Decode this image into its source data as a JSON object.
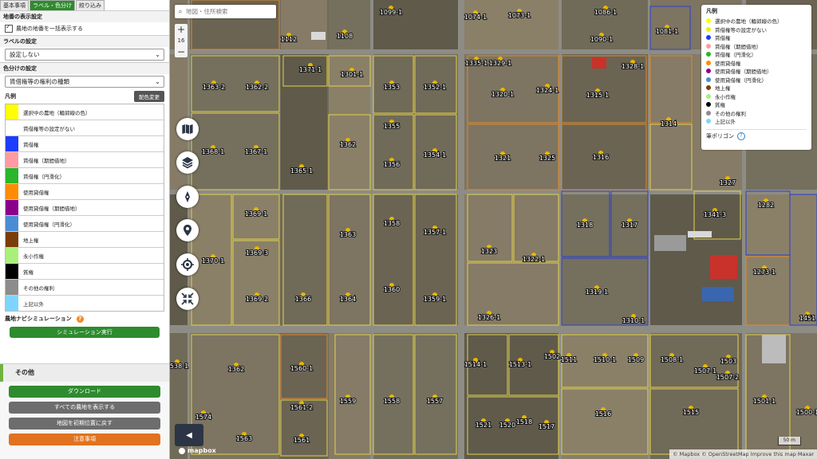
{
  "tabs": [
    "基本事項",
    "ラベル・色分け",
    "絞り込み"
  ],
  "display": {
    "section_title": "地番の表示設定",
    "show_all_label": "農地の地番を一括表示する"
  },
  "label_setting": {
    "title": "ラベルの設定",
    "value": "設定しない"
  },
  "color_setting": {
    "title": "色分けの設定",
    "value": "賃借権等の権利の種類"
  },
  "legend": {
    "title": "凡例",
    "change_button": "配色変更",
    "items": [
      {
        "label": "選択中の農地（輪郭線の色）",
        "color": "#ffff00"
      },
      {
        "label": "賃借権等の設定がない",
        "color": "#ffffff"
      },
      {
        "label": "賃借権",
        "color": "#1a3dff"
      },
      {
        "label": "賃借権（期間借地）",
        "color": "#ff9aa2"
      },
      {
        "label": "賃借権（円滑化）",
        "color": "#2ab52a"
      },
      {
        "label": "使用貸借権",
        "color": "#ff8c00"
      },
      {
        "label": "使用貸借権（期間借地）",
        "color": "#8b008b"
      },
      {
        "label": "使用貸借権（円滑化）",
        "color": "#4a8cd4"
      },
      {
        "label": "地上権",
        "color": "#7a3d0a"
      },
      {
        "label": "永小作権",
        "color": "#a8f07a"
      },
      {
        "label": "質権",
        "color": "#000000"
      },
      {
        "label": "その他の権利",
        "color": "#8c8c8c"
      },
      {
        "label": "上記以外",
        "color": "#7fd4ff"
      }
    ]
  },
  "simulation": {
    "title": "農地ナビシミュレーション",
    "run_button": "シミュレーション実行"
  },
  "others": {
    "title": "その他",
    "download": "ダウンロード",
    "show_all": "すべての農地を表示する",
    "reset_map": "地図を初期位置に戻す",
    "notes": "注意事項"
  },
  "search": {
    "placeholder": "地図・住所検索"
  },
  "zoom": {
    "plus": "+",
    "level": "16",
    "minus": "−"
  },
  "map_legend": {
    "title": "凡例",
    "items": [
      {
        "label": "選択中の農地（輪郭線の色）",
        "color": "#ffff00"
      },
      {
        "label": "賃借権等の設定がない",
        "color": "#f0f000"
      },
      {
        "label": "賃借権",
        "color": "#1a3dff"
      },
      {
        "label": "賃借権（期間借地）",
        "color": "#ff9aa2"
      },
      {
        "label": "賃借権（円滑化）",
        "color": "#2ab52a"
      },
      {
        "label": "使用貸借権",
        "color": "#ff8c00"
      },
      {
        "label": "使用貸借権（期間借地）",
        "color": "#8b008b"
      },
      {
        "label": "使用貸借権（円滑化）",
        "color": "#4a8cd4"
      },
      {
        "label": "地上権",
        "color": "#7a3d0a"
      },
      {
        "label": "永小作権",
        "color": "#a8f07a"
      },
      {
        "label": "質権",
        "color": "#000000"
      },
      {
        "label": "その他の権利",
        "color": "#8c8c8c"
      },
      {
        "label": "上記以外",
        "color": "#7fd4ff"
      }
    ],
    "polygon_label": "筆ポリゴン"
  },
  "map_footer": {
    "logo": "mapbox",
    "attribution": "© Mapbox © OpenStreetMap Improve this map Maxar",
    "scale": "50 m"
  },
  "plots": [
    "1099-1",
    "1074-1",
    "1073-1",
    "1086-1",
    "1081-1",
    "1112",
    "1108",
    "1090-1",
    "1335-1",
    "1329-1",
    "1328-1",
    "1371-1",
    "1301-1",
    "1363-2",
    "1362-2",
    "1353",
    "1352-1",
    "1320-1",
    "1324-1",
    "1315-1",
    "1314",
    "1355",
    "1362",
    "1354-1",
    "1321",
    "1325",
    "1316",
    "1368-1",
    "1367-1",
    "1356",
    "1365-1",
    "1327",
    "1369-1",
    "1363",
    "1358",
    "1357-1",
    "1318",
    "1317",
    "1341-3",
    "1282",
    "1370-1",
    "1369-3",
    "1323",
    "1322-1",
    "1273-1",
    "1369-2",
    "1366",
    "1364",
    "1360",
    "1359-1",
    "1319-1",
    "1326-1",
    "1310-1",
    "1451",
    "1362",
    "1560-1",
    "1514-1",
    "1513-1",
    "1502",
    "1511",
    "1510-1",
    "1509",
    "1508-1",
    "1507-1",
    "1507-2",
    "1503",
    "1501-1",
    "1538-1",
    "1574",
    "1561-2",
    "1559",
    "1558",
    "1557",
    "1516",
    "1515",
    "1500-1",
    "1563",
    "1561",
    "1521",
    "1520",
    "1518",
    "1517"
  ]
}
